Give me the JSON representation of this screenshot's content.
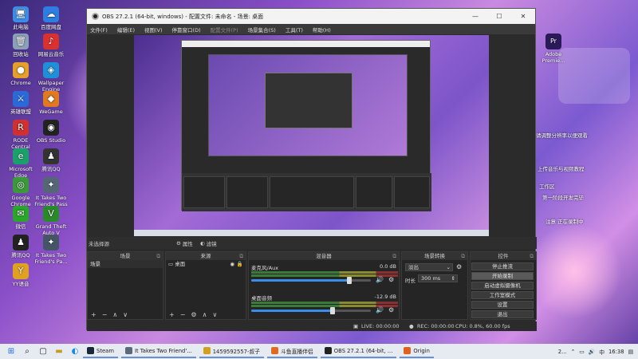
{
  "desktop": {
    "icons_left": [
      {
        "label": "此电脑",
        "glyph": "🖥",
        "color": "#3b8ee8"
      },
      {
        "label": "百度网盘",
        "glyph": "☁",
        "color": "#2f7de1"
      },
      {
        "label": "回收站",
        "glyph": "🗑",
        "color": "#8aa0b8"
      },
      {
        "label": "网易云音乐",
        "glyph": "♪",
        "color": "#d93030"
      },
      {
        "label": "Chrome",
        "glyph": "●",
        "color": "#e5a02a"
      },
      {
        "label": "Wallpaper Engine",
        "glyph": "◈",
        "color": "#1e90d8"
      },
      {
        "label": "英雄联盟",
        "glyph": "⚔",
        "color": "#2a6ad8"
      },
      {
        "label": "WeGame",
        "glyph": "◆",
        "color": "#e07a20"
      },
      {
        "label": "RODE Central",
        "glyph": "R",
        "color": "#d03030"
      },
      {
        "label": "OBS Studio",
        "glyph": "◉",
        "color": "#222222"
      },
      {
        "label": "Microsoft Edge",
        "glyph": "e",
        "color": "#1aa06a"
      },
      {
        "label": "腾讯QQ",
        "glyph": "♟",
        "color": "#333333"
      },
      {
        "label": "Google Chrome",
        "glyph": "◎",
        "color": "#3a9a3a"
      },
      {
        "label": "It Takes Two Friend's Pass",
        "glyph": "✦",
        "color": "#556677"
      },
      {
        "label": "微信",
        "glyph": "✉",
        "color": "#2aa62a"
      },
      {
        "label": "Grand Theft Auto V",
        "glyph": "V",
        "color": "#2a8a2a"
      },
      {
        "label": "腾讯QQ",
        "glyph": "♟",
        "color": "#222222"
      },
      {
        "label": "It Takes Two Friend's Pa...",
        "glyph": "✦",
        "color": "#445566"
      },
      {
        "label": "YY语音",
        "glyph": "Y",
        "color": "#e0a020"
      }
    ],
    "icons_right": [
      {
        "label": "Adobe Premie...",
        "glyph": "Pr",
        "color": "#2a1a5a"
      }
    ],
    "notes": [
      "请调整分辨率以便观看",
      "上传音乐与视频教程",
      "工作区",
      "第一阶段开发完毕",
      "注意 正在录制中"
    ]
  },
  "obs": {
    "title": "OBS 27.2.1 (64-bit, windows) - 配置文件: 未命名 - 场景: 桌面",
    "menu": [
      "文件(F)",
      "编辑(E)",
      "视图(V)",
      "停靠窗口(D)",
      "配置文件(P)",
      "场景集合(S)",
      "工具(T)",
      "帮助(H)"
    ],
    "no_source": "未选择源",
    "properties": "属性",
    "filters": "滤镜",
    "docks": {
      "scenes": {
        "title": "场景",
        "items": [
          "场景"
        ]
      },
      "sources": {
        "title": "来源",
        "items": [
          "桌面"
        ]
      },
      "mixer": {
        "title": "混音器",
        "channels": [
          {
            "name": "麦克风/Aux",
            "db": "0.0 dB",
            "level": 0.82
          },
          {
            "name": "桌面音频",
            "db": "-12.9 dB",
            "level": 0.68
          }
        ]
      },
      "transitions": {
        "title": "场景转换",
        "type": "淡出",
        "duration_label": "时长",
        "duration": "300 ms"
      },
      "controls": {
        "title": "控件",
        "buttons": [
          "停止推流",
          "开始录制",
          "启动虚拟摄像机",
          "工作室模式",
          "设置",
          "退出"
        ]
      }
    },
    "status": {
      "live": "LIVE: 00:00:00",
      "rec": "REC: 00:00:00",
      "cpu": "CPU: 0.8%, 60.00 fps"
    }
  },
  "taskbar": {
    "items": [
      {
        "label": "Steam",
        "color": "#1b2838"
      },
      {
        "label": "It Takes Two Friend'...",
        "color": "#5a6a7a"
      },
      {
        "label": "1459592557-叔子",
        "color": "#d0a020"
      },
      {
        "label": "斗鱼直播伴侣",
        "color": "#e06a20"
      },
      {
        "label": "OBS 27.2.1 (64-bit, ...",
        "color": "#222222"
      },
      {
        "label": "Origin",
        "color": "#e06020"
      }
    ],
    "tray_count": "2...",
    "lang": "中",
    "time": "16:38"
  }
}
